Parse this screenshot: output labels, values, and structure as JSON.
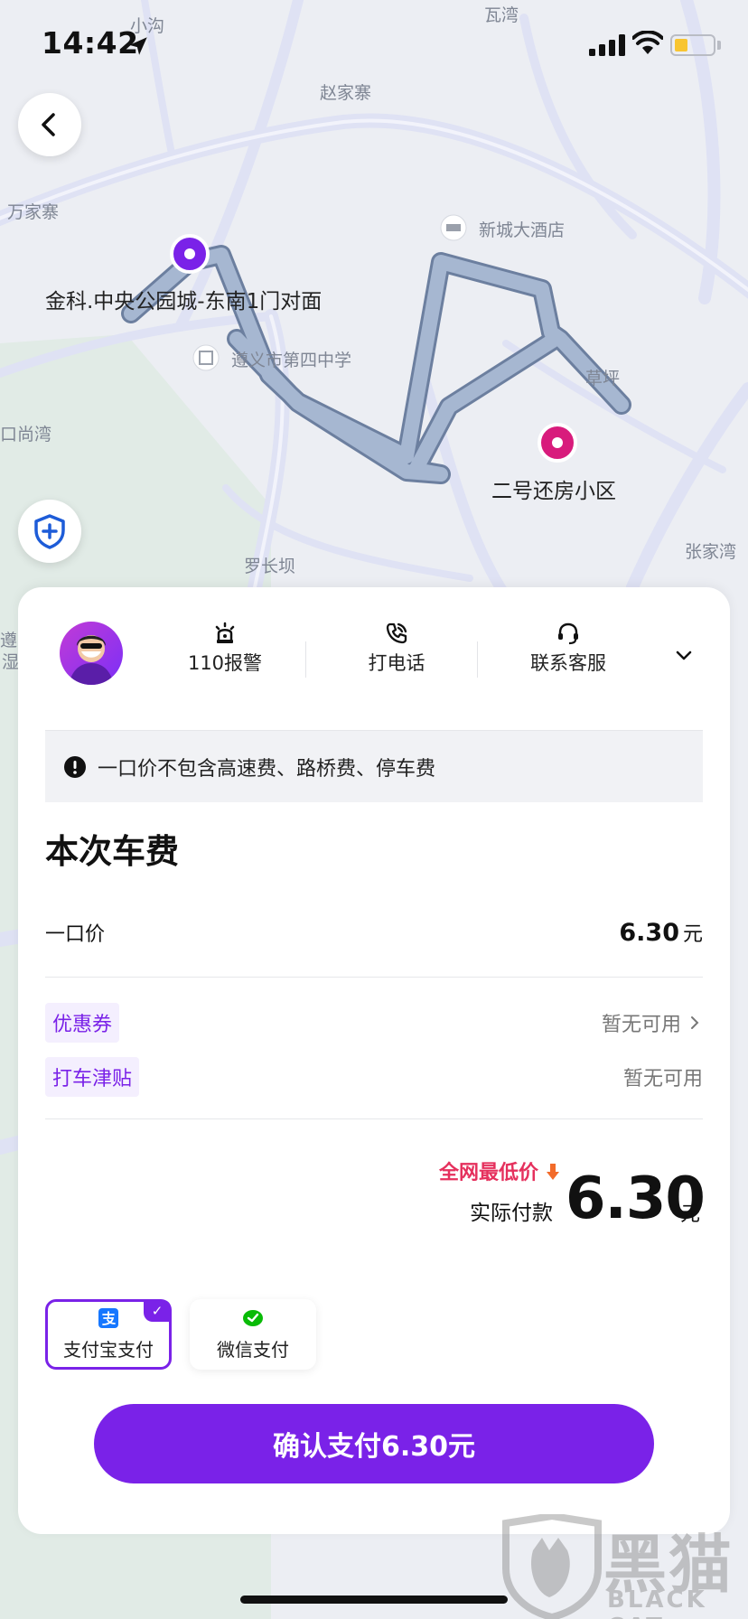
{
  "status_bar": {
    "time": "14:42"
  },
  "map": {
    "labels": [
      "小沟",
      "瓦湾",
      "赵家寨",
      "万家寨",
      "新城大酒店",
      "遵义市第四中学",
      "草坪",
      "口尚湾",
      "罗长坝",
      "张家湾",
      "遵",
      "湿"
    ],
    "origin_name": "金科.中央公园城-东南1门对面",
    "destination_name": "二号还房小区",
    "route_color": "#8ea2c2",
    "origin_color": "#7a22e8",
    "destination_color": "#d81b7c"
  },
  "actions": {
    "police": "110报警",
    "call": "打电话",
    "service": "联系客服"
  },
  "notice": "一口价不包含高速费、路桥费、停车费",
  "fee": {
    "title": "本次车费",
    "fixed_label": "一口价",
    "fixed_amount": "6.30",
    "unit": "元",
    "coupon_label": "优惠券",
    "coupon_status": "暂无可用",
    "subsidy_label": "打车津贴",
    "subsidy_status": "暂无可用",
    "lowest_price": "全网最低价",
    "actual_label": "实际付款",
    "actual_amount": "6.30"
  },
  "payment": {
    "alipay": "支付宝支付",
    "wechat": "微信支付",
    "selected": "alipay",
    "confirm": "确认支付6.30元"
  },
  "watermark": {
    "cn": "黑猫",
    "en": "BLACK CAT"
  },
  "colors": {
    "accent": "#7a22e8",
    "alipay": "#1677ff",
    "wechat": "#09bb07",
    "lowest": "#e5305d"
  }
}
